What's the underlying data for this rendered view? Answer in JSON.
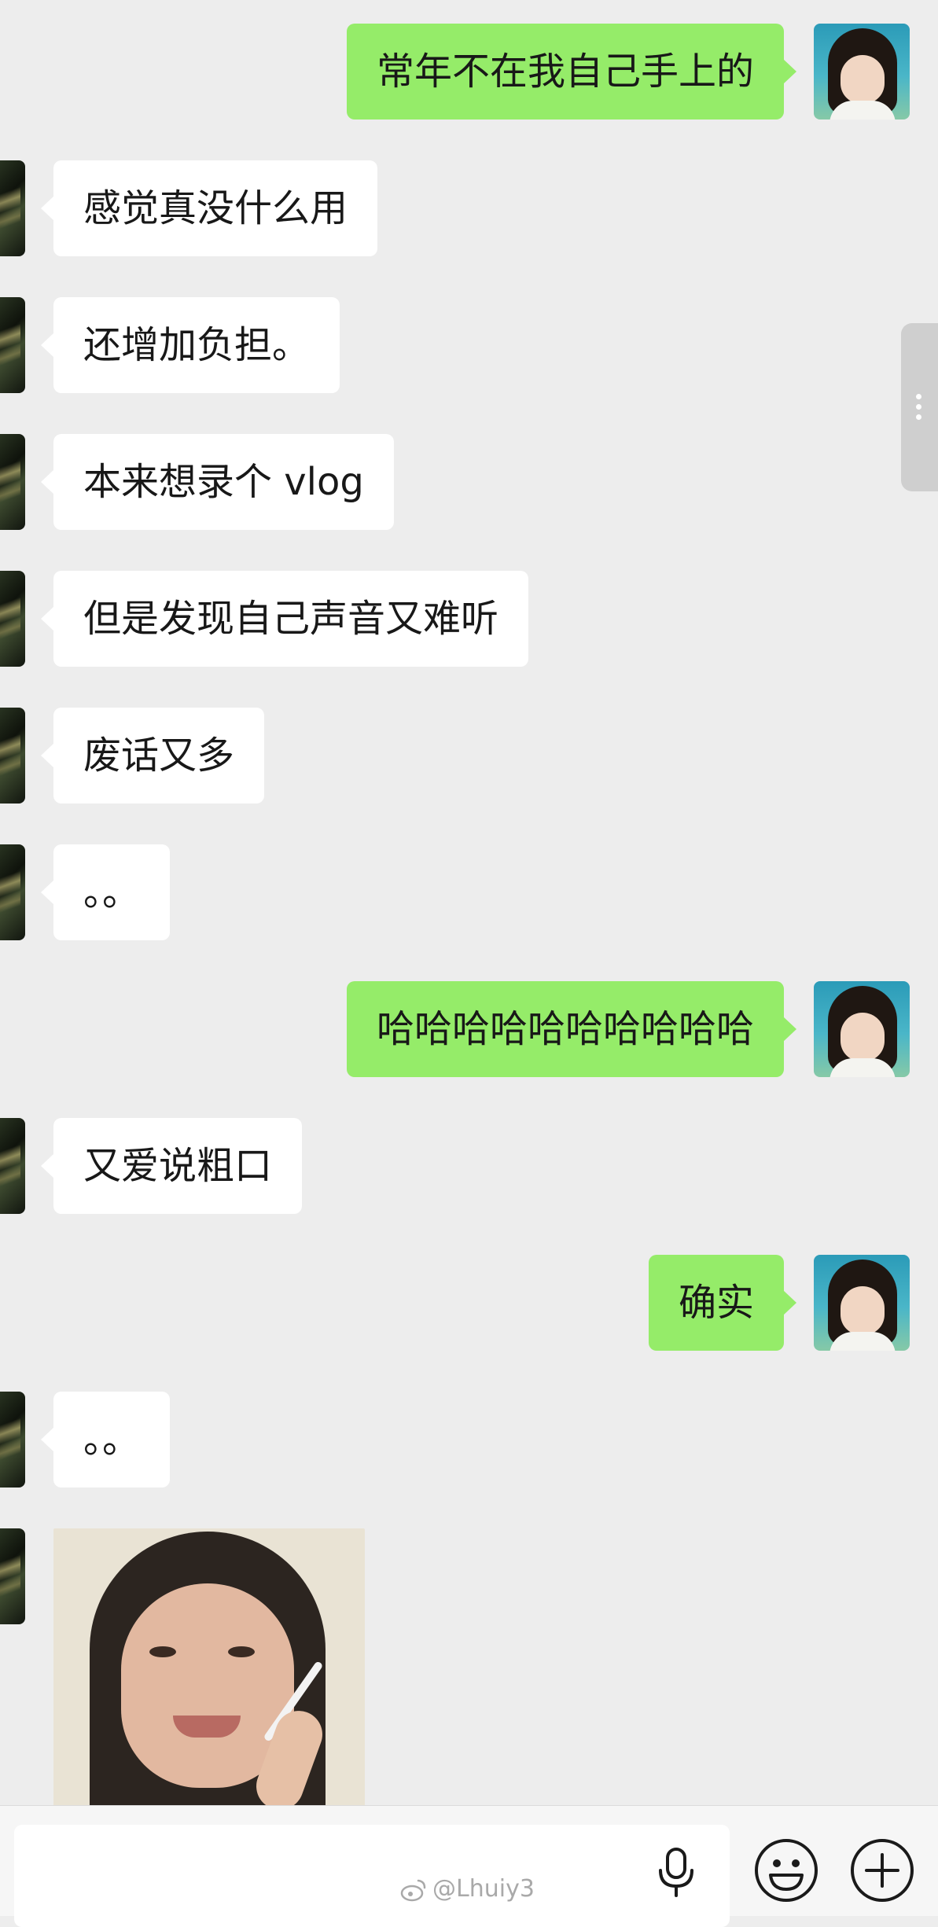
{
  "messages": [
    {
      "side": "out",
      "type": "text",
      "text": "常年不在我自己手上的"
    },
    {
      "side": "in",
      "type": "text",
      "text": "感觉真没什么用"
    },
    {
      "side": "in",
      "type": "text",
      "text": "还增加负担。"
    },
    {
      "side": "in",
      "type": "text",
      "text": "本来想录个 vlog"
    },
    {
      "side": "in",
      "type": "text",
      "text": "但是发现自己声音又难听"
    },
    {
      "side": "in",
      "type": "text",
      "text": "废话又多"
    },
    {
      "side": "in",
      "type": "text",
      "text": "。。"
    },
    {
      "side": "out",
      "type": "text",
      "text": "哈哈哈哈哈哈哈哈哈哈"
    },
    {
      "side": "in",
      "type": "text",
      "text": "又爱说粗口"
    },
    {
      "side": "out",
      "type": "text",
      "text": "确实"
    },
    {
      "side": "in",
      "type": "text",
      "text": "。。"
    },
    {
      "side": "in",
      "type": "image",
      "description": "sticker-photo"
    }
  ],
  "input_bar": {
    "watermark": "@Lhuiy3",
    "icons": [
      "mic-icon",
      "emoji-icon",
      "plus-icon"
    ]
  },
  "colors": {
    "background": "#ededed",
    "outgoing_bubble": "#95ec69",
    "incoming_bubble": "#ffffff"
  }
}
